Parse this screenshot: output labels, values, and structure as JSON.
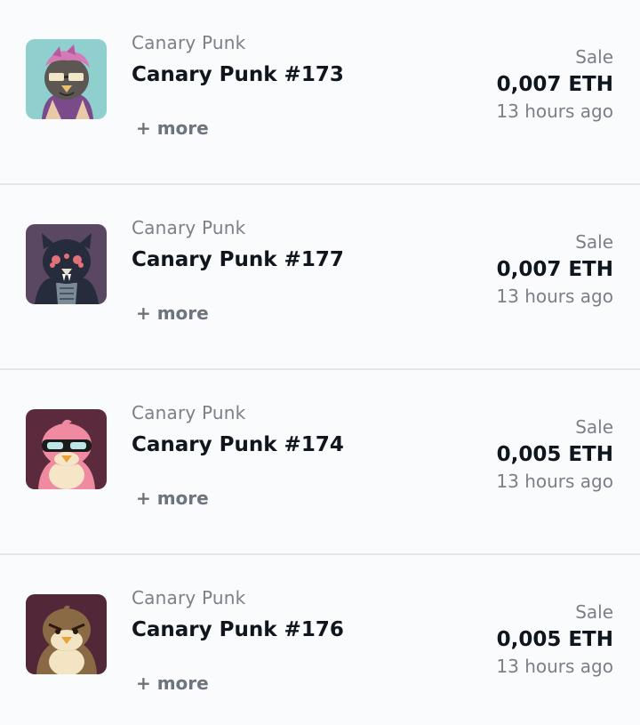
{
  "activity": [
    {
      "collection": "Canary Punk",
      "name": "Canary Punk #173",
      "more": "+ more",
      "event": "Sale",
      "price": "0,007 ETH",
      "time": "13 hours ago",
      "thumb_bg": "#8fd0ce"
    },
    {
      "collection": "Canary Punk",
      "name": "Canary Punk #177",
      "more": "+ more",
      "event": "Sale",
      "price": "0,007 ETH",
      "time": "13 hours ago",
      "thumb_bg": "#5a4863"
    },
    {
      "collection": "Canary Punk",
      "name": "Canary Punk #174",
      "more": "+ more",
      "event": "Sale",
      "price": "0,005 ETH",
      "time": "13 hours ago",
      "thumb_bg": "#5b2a3d"
    },
    {
      "collection": "Canary Punk",
      "name": "Canary Punk #176",
      "more": "+ more",
      "event": "Sale",
      "price": "0,005 ETH",
      "time": "13 hours ago",
      "thumb_bg": "#522838"
    }
  ]
}
